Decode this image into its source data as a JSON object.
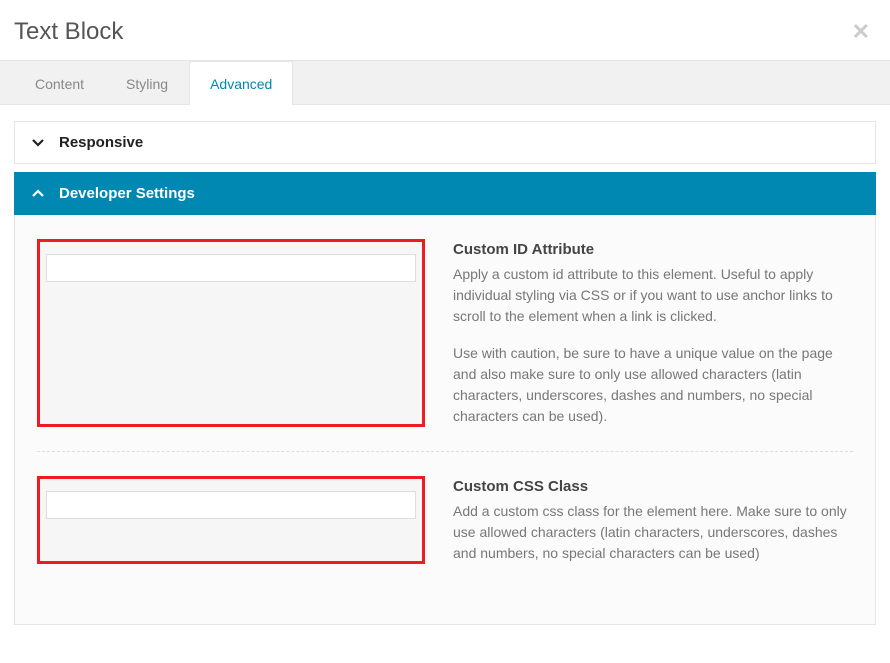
{
  "modal": {
    "title": "Text Block"
  },
  "tabs": {
    "content": "Content",
    "styling": "Styling",
    "advanced": "Advanced"
  },
  "sections": {
    "responsive": {
      "title": "Responsive"
    },
    "developer": {
      "title": "Developer Settings",
      "fields": {
        "custom_id": {
          "label": "Custom ID Attribute",
          "value": "",
          "desc1": "Apply a custom id attribute to this element. Useful to apply individual styling via CSS or if you want to use anchor links to scroll to the element when a link is clicked.",
          "desc2": "Use with caution, be sure to have a unique value on the page and also make sure to only use allowed characters (latin characters, underscores, dashes and numbers, no special characters can be used)."
        },
        "custom_class": {
          "label": "Custom CSS Class",
          "value": "",
          "desc1": "Add a custom css class for the element here. Make sure to only use allowed characters (latin characters, underscores, dashes and numbers, no special characters can be used)"
        }
      }
    }
  }
}
